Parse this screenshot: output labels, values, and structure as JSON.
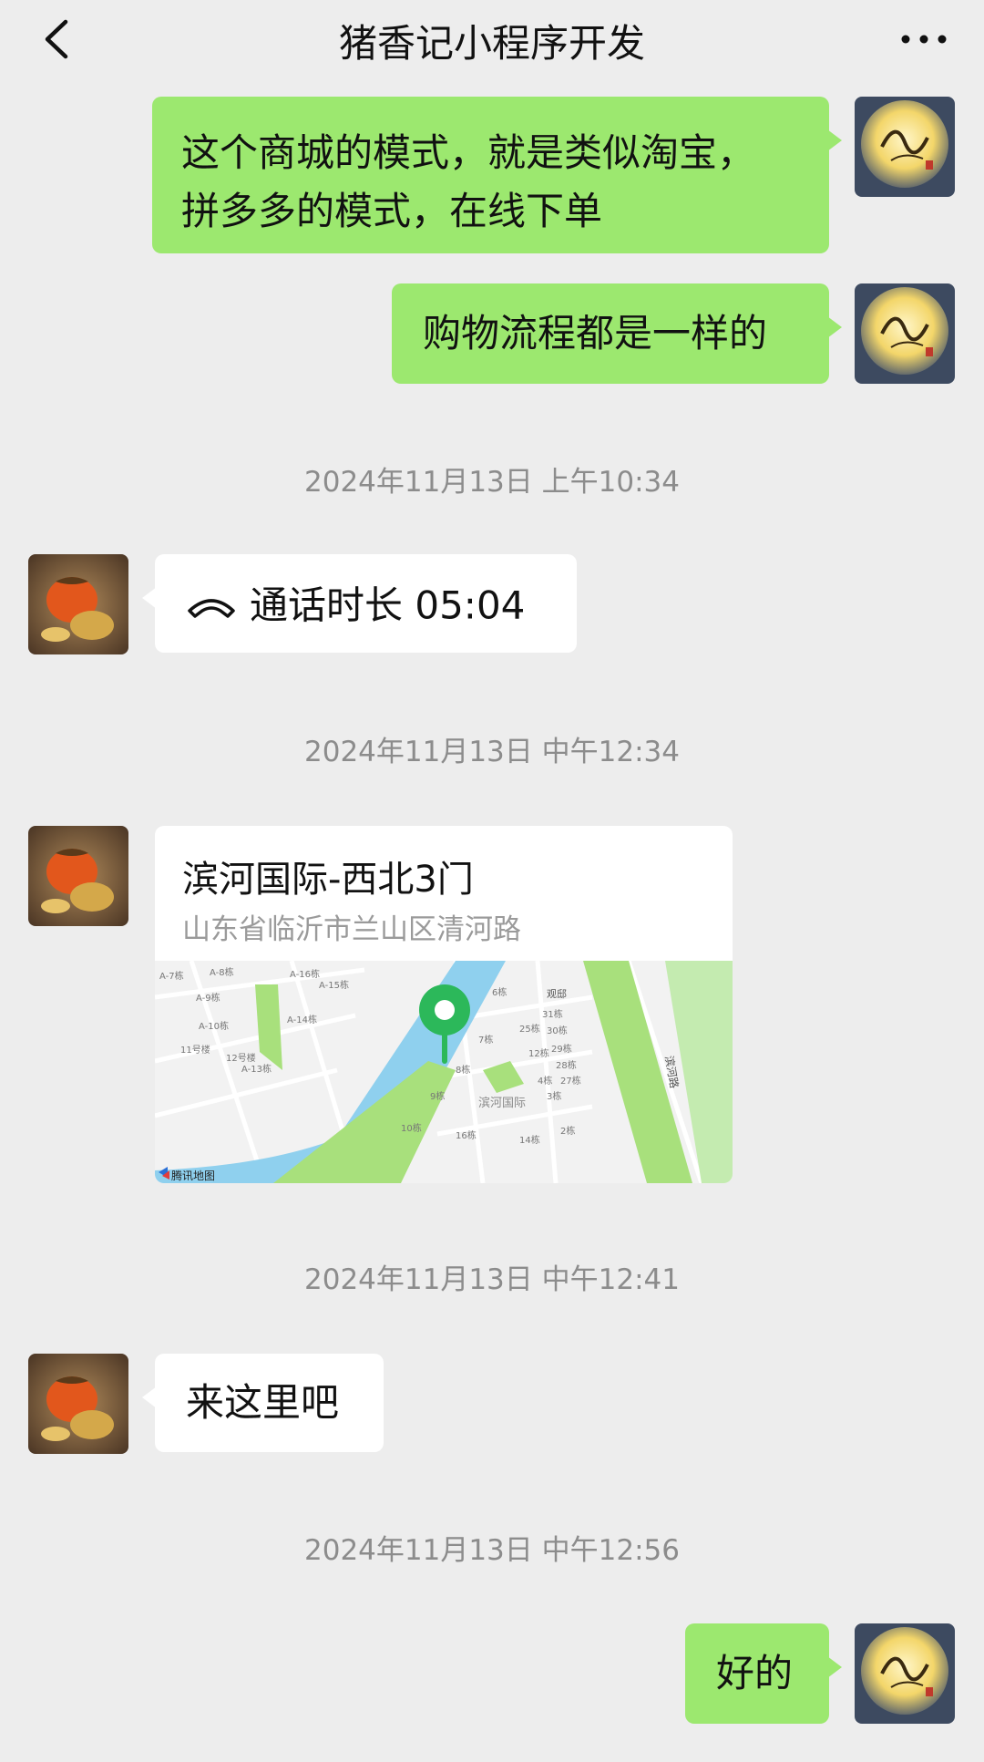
{
  "header": {
    "title": "猪香记小程序开发",
    "back_icon": "chevron-left-icon",
    "more_icon": "more-dots-icon"
  },
  "messages": [
    {
      "side": "self",
      "type": "text",
      "lines": [
        "这个商城的模式，就是类似淘宝，",
        "拼多多的模式，在线下单"
      ]
    },
    {
      "side": "self",
      "type": "text",
      "text": "购物流程都是一样的"
    },
    {
      "type": "timestamp",
      "text": "2024年11月13日 上午10:34"
    },
    {
      "side": "other",
      "type": "call",
      "icon": "phone-hangup-icon",
      "text": "通话时长 05:04"
    },
    {
      "type": "timestamp",
      "text": "2024年11月13日 中午12:34"
    },
    {
      "side": "other",
      "type": "location",
      "name": "滨河国际-西北3门",
      "address": "山东省临沂市兰山区清河路",
      "map_provider": "腾讯地图"
    },
    {
      "type": "timestamp",
      "text": "2024年11月13日 中午12:41"
    },
    {
      "side": "other",
      "type": "text",
      "text": "来这里吧"
    },
    {
      "type": "timestamp",
      "text": "2024年11月13日 中午12:56"
    },
    {
      "side": "self",
      "type": "text",
      "text": "好的"
    }
  ],
  "map_labels": [
    "A-7栋",
    "A-8栋",
    "A-16栋",
    "A-15栋",
    "A-9栋",
    "A-14栋",
    "A-10栋",
    "11号楼",
    "12号楼",
    "A-13栋",
    "6栋",
    "7栋",
    "8栋",
    "9栋",
    "10栋",
    "16栋",
    "14栋",
    "25栋",
    "31栋",
    "30栋",
    "29栋",
    "28栋",
    "27栋",
    "12栋",
    "4栋",
    "3栋",
    "2栋",
    "滨河国际",
    "滨河路",
    "观邸"
  ],
  "colors": {
    "background": "#ededed",
    "self_bubble": "#9ce86f",
    "other_bubble": "#ffffff",
    "timestamp_text": "#8c8c8c",
    "map_river": "#8fd0ee",
    "map_park": "#a8e07c",
    "pin": "#2cb85a"
  }
}
